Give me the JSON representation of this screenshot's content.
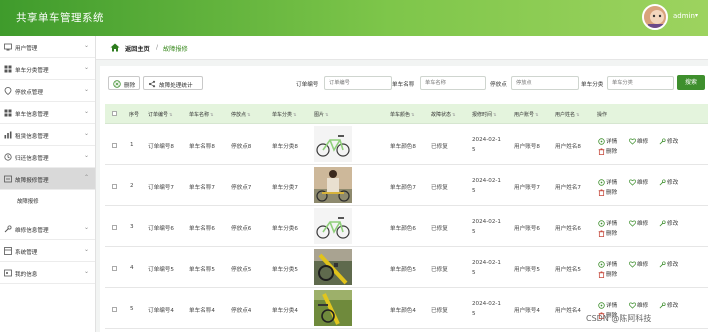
{
  "app": {
    "title": "共享单车管理系统",
    "user": "admin",
    "caret": "▾"
  },
  "sidebar": {
    "items": [
      {
        "label": "用户管理"
      },
      {
        "label": "单车分类管理"
      },
      {
        "label": "停放点管理"
      },
      {
        "label": "单车信息管理"
      },
      {
        "label": "租赁信息管理"
      },
      {
        "label": "归还信息管理"
      },
      {
        "label": "故障报修管理"
      },
      {
        "label": "维修信息管理"
      },
      {
        "label": "系统管理"
      },
      {
        "label": "我的信息"
      }
    ],
    "sub_item": "故障报修"
  },
  "breadcrumb": {
    "home": "返回主页",
    "separator": "/",
    "current": "故障报修"
  },
  "toolbar": {
    "delete_label": "删除",
    "stats_label": "故障处理统计",
    "search_label": "搜索",
    "filters": [
      {
        "label": "订单编号",
        "placeholder": "订单编号"
      },
      {
        "label": "单车名称",
        "placeholder": "单车名称"
      },
      {
        "label": "停放点",
        "placeholder": "停放点"
      },
      {
        "label": "单车分类",
        "placeholder": "单车分类"
      }
    ]
  },
  "table": {
    "columns": [
      "序号",
      "订单编号",
      "单车名称",
      "停放点",
      "单车分类",
      "图片",
      "单车颜色",
      "故障状态",
      "报修时间",
      "用户账号",
      "用户姓名",
      "操作"
    ],
    "rows": [
      {
        "index": "1",
        "order": "订单编号8",
        "name": "单车名称8",
        "spot": "停放点8",
        "category": "单车分类8",
        "picture": "bike-white",
        "color": "单车颜色8",
        "status": "已修复",
        "time_a": "2024-02-1",
        "time_b": "5",
        "account": "用户账号8",
        "username": "用户姓名8"
      },
      {
        "index": "2",
        "order": "订单编号7",
        "name": "单车名称7",
        "spot": "停放点7",
        "category": "单车分类7",
        "picture": "bike-person",
        "color": "单车颜色7",
        "status": "已修复",
        "time_a": "2024-02-1",
        "time_b": "5",
        "account": "用户账号7",
        "username": "用户姓名7"
      },
      {
        "index": "3",
        "order": "订单编号6",
        "name": "单车名称6",
        "spot": "停放点6",
        "category": "单车分类6",
        "picture": "bike-white",
        "color": "单车颜色6",
        "status": "已修复",
        "time_a": "2024-02-1",
        "time_b": "5",
        "account": "用户账号6",
        "username": "用户姓名6"
      },
      {
        "index": "4",
        "order": "订单编号5",
        "name": "单车名称5",
        "spot": "停放点5",
        "category": "单车分类5",
        "picture": "bike-yellow",
        "color": "单车颜色5",
        "status": "已修复",
        "time_a": "2024-02-1",
        "time_b": "5",
        "account": "用户账号5",
        "username": "用户姓名5"
      },
      {
        "index": "5",
        "order": "订单编号4",
        "name": "单车名称4",
        "spot": "停放点4",
        "category": "单车分类4",
        "picture": "bike-yellow-green",
        "color": "单车颜色4",
        "status": "已修复",
        "time_a": "2024-02-1",
        "time_b": "5",
        "account": "用户账号4",
        "username": "用户姓名4"
      }
    ],
    "actions": {
      "detail": "详情",
      "repair": "维修",
      "edit": "修改",
      "delete": "删除"
    }
  },
  "watermark": "CSDN @陈阿科技",
  "colors": {
    "brand": "#3e8f2d",
    "header_start": "#3f9b2c",
    "header_end": "#9dd35f",
    "table_head": "#e4f4dd"
  }
}
